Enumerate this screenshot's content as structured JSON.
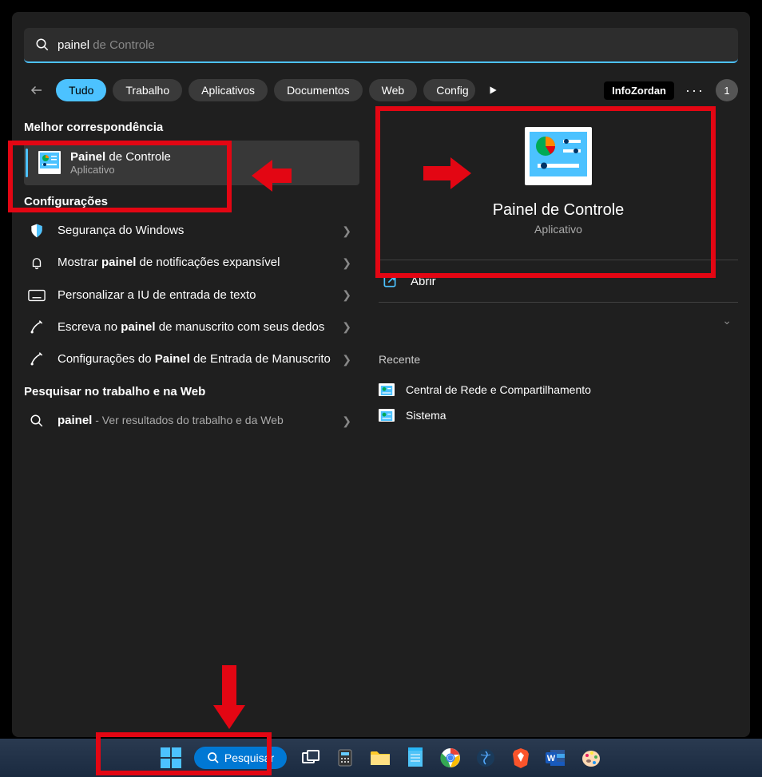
{
  "search": {
    "typed": "painel",
    "suggestion": " de Controle"
  },
  "filters": {
    "all": "Tudo",
    "work": "Trabalho",
    "apps": "Aplicativos",
    "docs": "Documentos",
    "web": "Web",
    "settings_partial": "Config"
  },
  "header": {
    "badge": "InfoZordan",
    "avatar_initial": "1"
  },
  "left": {
    "best_match_header": "Melhor correspondência",
    "best_match": {
      "title_bold": "Painel",
      "title_rest": " de Controle",
      "subtitle": "Aplicativo"
    },
    "settings_header": "Configurações",
    "settings_items": [
      {
        "pre": "",
        "bold": "",
        "post": "Segurança do Windows",
        "icon": "shield"
      },
      {
        "pre": "Mostrar ",
        "bold": "painel",
        "post": " de notificações expansível",
        "icon": "bell"
      },
      {
        "pre": "",
        "bold": "",
        "post": "Personalizar a IU de entrada de texto",
        "icon": "keyboard"
      },
      {
        "pre": "Escreva no ",
        "bold": "painel",
        "post": " de manuscrito com seus dedos",
        "icon": "pen"
      },
      {
        "pre": "Configurações do ",
        "bold": "Painel",
        "post": " de Entrada de Manuscrito",
        "icon": "pen"
      }
    ],
    "web_header": "Pesquisar no trabalho e na Web",
    "web_item": {
      "term": "painel",
      "desc": " - Ver resultados do trabalho e da Web"
    }
  },
  "right": {
    "title": "Painel de Controle",
    "subtitle": "Aplicativo",
    "open": "Abrir",
    "recent_header": "Recente",
    "recent": [
      "Central de Rede e Compartilhamento",
      "Sistema"
    ]
  },
  "taskbar": {
    "search_label": "Pesquisar"
  }
}
